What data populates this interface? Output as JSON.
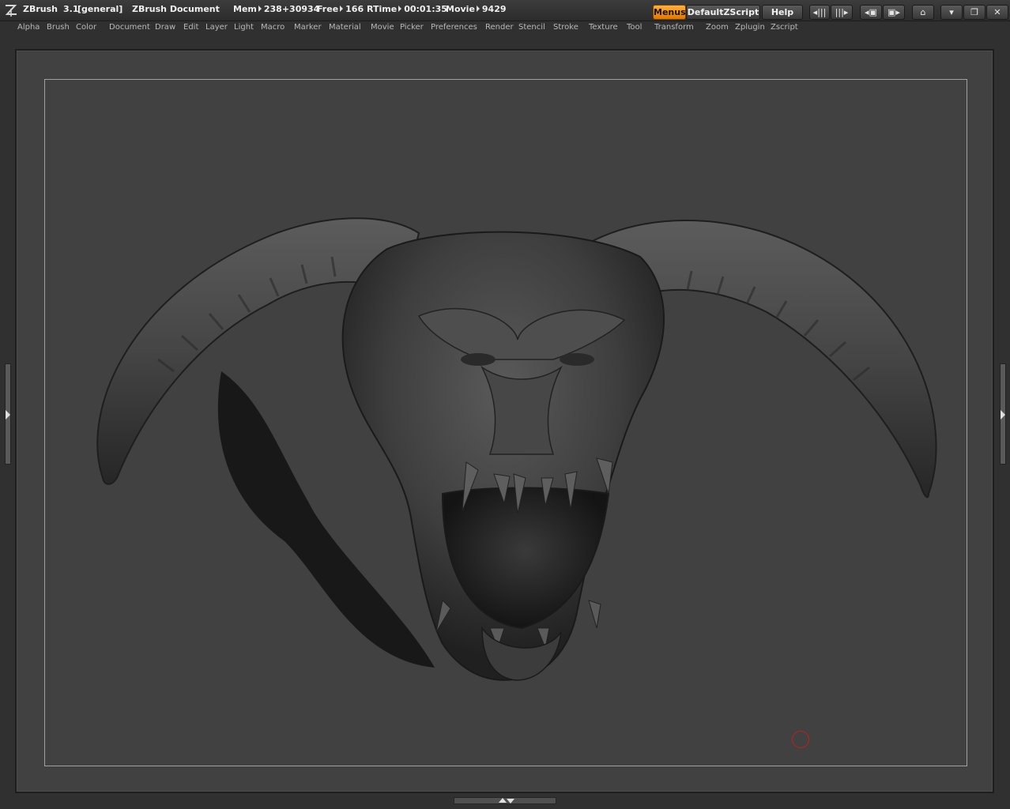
{
  "titlebar": {
    "app_name": "ZBrush",
    "version": "3.1",
    "layout": "[general]",
    "document": "ZBrush Document",
    "mem_label": "Mem",
    "mem_value": "238+30934",
    "free_label": "Free",
    "free_value": "166",
    "rtime_label": "RTime",
    "rtime_value": "00:01:35",
    "movie_label": "Movie",
    "movie_value": "9429",
    "menus_button": "Menus",
    "script_button": "DefaultZScript",
    "help_button": "Help"
  },
  "menubar": {
    "items": [
      "Alpha",
      "Brush",
      "Color",
      "Document",
      "Draw",
      "Edit",
      "Layer",
      "Light",
      "Macro",
      "Marker",
      "Material",
      "Movie",
      "Picker",
      "Preferences",
      "Render",
      "Stencil",
      "Stroke",
      "Texture",
      "Tool",
      "Transform",
      "Zoom",
      "Zplugin",
      "Zscript"
    ]
  },
  "colors": {
    "accent": "#f08c1a",
    "canvas": "#414141",
    "chrome": "#303030",
    "brush_cursor": "#c02020"
  },
  "icons": [
    "zbrush-logo-icon",
    "scroll-left-icon",
    "scroll-right-icon",
    "layout-icon-1",
    "layout-icon-2",
    "lock-icon",
    "minimize-icon",
    "restore-icon",
    "close-icon"
  ]
}
